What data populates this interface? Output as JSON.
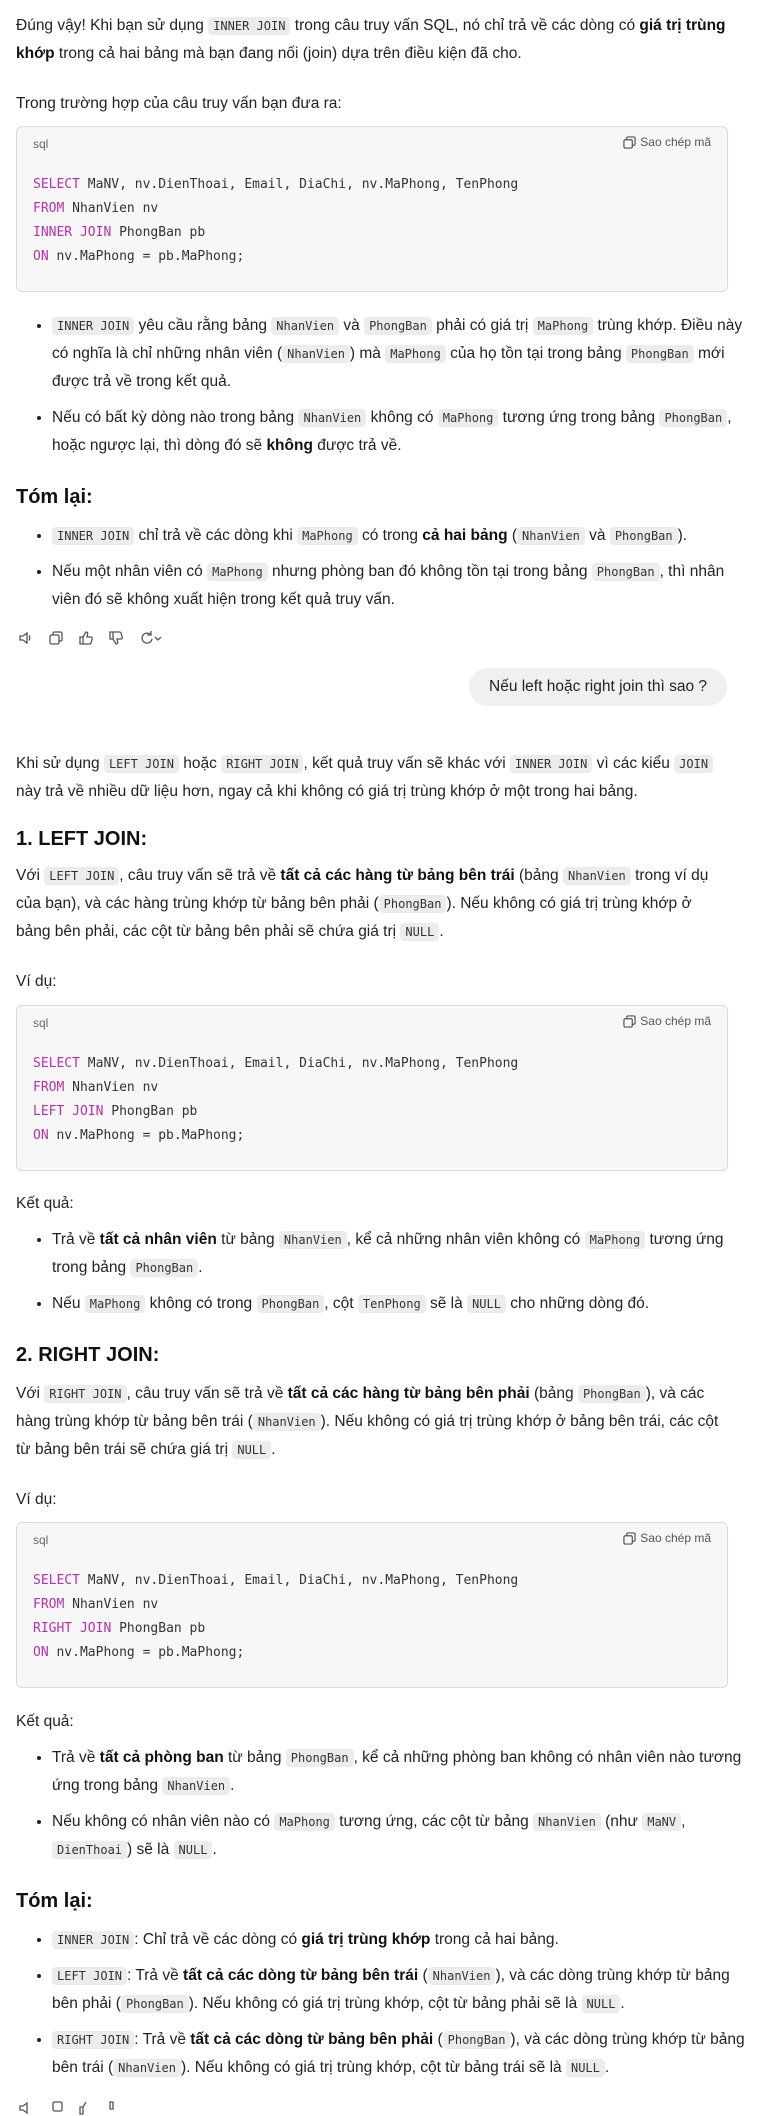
{
  "intro": {
    "p1_a": "Đúng vậy! Khi bạn sử dụng ",
    "p1_code": "INNER JOIN",
    "p1_b": " trong câu truy vấn SQL, nó chỉ trả về các dòng có ",
    "p1_bold": "giá trị trùng khớp",
    "p1_c": " trong cả hai bảng mà bạn đang nối (join) dựa trên điều kiện đã cho.",
    "p2": "Trong trường hợp của câu truy vấn bạn đưa ra:"
  },
  "code_ui": {
    "lang": "sql",
    "copy_label": "Sao chép mã"
  },
  "code1": {
    "l1_kw": "SELECT",
    "l1": " MaNV, nv.DienThoai, Email, DiaChi, nv.MaPhong, TenPhong",
    "l2_kw": "FROM",
    "l2": " NhanVien nv",
    "l3_kw": "INNER JOIN",
    "l3": " PhongBan pb",
    "l4_kw": "ON",
    "l4": " nv.MaPhong = pb.MaPhong;"
  },
  "bullets1": {
    "b1_code1": "INNER JOIN",
    "b1_a": " yêu cầu rằng bảng ",
    "b1_code2": "NhanVien",
    "b1_b": " và ",
    "b1_code3": "PhongBan",
    "b1_c": " phải có giá trị ",
    "b1_code4": "MaPhong",
    "b1_d": " trùng khớp. Điều này có nghĩa là chỉ những nhân viên (",
    "b1_code5": "NhanVien",
    "b1_e": ") mà ",
    "b1_code6": "MaPhong",
    "b1_f": " của họ tồn tại trong bảng ",
    "b1_code7": "PhongBan",
    "b1_g": " mới được trả về trong kết quả.",
    "b2_a": "Nếu có bất kỳ dòng nào trong bảng ",
    "b2_code1": "NhanVien",
    "b2_b": " không có ",
    "b2_code2": "MaPhong",
    "b2_c": " tương ứng trong bảng ",
    "b2_code3": "PhongBan",
    "b2_d": ", hoặc ngược lại, thì dòng đó sẽ ",
    "b2_bold": "không",
    "b2_e": " được trả về."
  },
  "summary1": {
    "title": "Tóm lại:",
    "s1_code1": "INNER JOIN",
    "s1_a": " chỉ trả về các dòng khi ",
    "s1_code2": "MaPhong",
    "s1_b": " có trong ",
    "s1_bold": "cả hai bảng",
    "s1_c": " (",
    "s1_code3": "NhanVien",
    "s1_d": " và ",
    "s1_code4": "PhongBan",
    "s1_e": ").",
    "s2_a": "Nếu một nhân viên có ",
    "s2_code1": "MaPhong",
    "s2_b": " nhưng phòng ban đó không tồn tại trong bảng ",
    "s2_code2": "PhongBan",
    "s2_c": ", thì nhân viên đó sẽ không xuất hiện trong kết quả truy vấn."
  },
  "user_message": "Nếu left hoặc right join thì sao ?",
  "answer": {
    "p1_a": "Khi sử dụng ",
    "p1_code1": "LEFT JOIN",
    "p1_b": " hoặc ",
    "p1_code2": "RIGHT JOIN",
    "p1_c": ", kết quả truy vấn sẽ khác với ",
    "p1_code3": "INNER JOIN",
    "p1_d": " vì các kiểu ",
    "p1_code4": "JOIN",
    "p1_e": " này trả về nhiều dữ liệu hơn, ngay cả khi không có giá trị trùng khớp ở một trong hai bảng."
  },
  "left": {
    "title": "1. LEFT JOIN:",
    "p_a": "Với ",
    "p_code1": "LEFT JOIN",
    "p_b": ", câu truy vấn sẽ trả về ",
    "p_bold": "tất cả các hàng từ bảng bên trái",
    "p_c": " (bảng ",
    "p_code2": "NhanVien",
    "p_d": " trong ví dụ của bạn), và các hàng trùng khớp từ bảng bên phải (",
    "p_code3": "PhongBan",
    "p_e": "). Nếu không có giá trị trùng khớp ở bảng bên phải, các cột từ bảng bên phải sẽ chứa giá trị ",
    "p_code4": "NULL",
    "p_f": ".",
    "example": "Ví dụ:",
    "result": "Kết quả:",
    "r1_a": "Trả về ",
    "r1_bold": "tất cả nhân viên",
    "r1_b": " từ bảng ",
    "r1_code1": "NhanVien",
    "r1_c": ", kể cả những nhân viên không có ",
    "r1_code2": "MaPhong",
    "r1_d": " tương ứng trong bảng ",
    "r1_code3": "PhongBan",
    "r1_e": ".",
    "r2_a": "Nếu ",
    "r2_code1": "MaPhong",
    "r2_b": " không có trong ",
    "r2_code2": "PhongBan",
    "r2_c": ", cột ",
    "r2_code3": "TenPhong",
    "r2_d": " sẽ là ",
    "r2_code4": "NULL",
    "r2_e": " cho những dòng đó."
  },
  "code2": {
    "l1_kw": "SELECT",
    "l1": " MaNV, nv.DienThoai, Email, DiaChi, nv.MaPhong, TenPhong",
    "l2_kw": "FROM",
    "l2": " NhanVien nv",
    "l3_kw": "LEFT JOIN",
    "l3": " PhongBan pb",
    "l4_kw": "ON",
    "l4": " nv.MaPhong = pb.MaPhong;"
  },
  "right": {
    "title": "2. RIGHT JOIN:",
    "p_a": "Với ",
    "p_code1": "RIGHT JOIN",
    "p_b": ", câu truy vấn sẽ trả về ",
    "p_bold": "tất cả các hàng từ bảng bên phải",
    "p_c": " (bảng ",
    "p_code2": "PhongBan",
    "p_d": "), và các hàng trùng khớp từ bảng bên trái (",
    "p_code3": "NhanVien",
    "p_e": "). Nếu không có giá trị trùng khớp ở bảng bên trái, các cột từ bảng bên trái sẽ chứa giá trị ",
    "p_code4": "NULL",
    "p_f": ".",
    "example": "Ví dụ:",
    "result": "Kết quả:",
    "r1_a": "Trả về ",
    "r1_bold": "tất cả phòng ban",
    "r1_b": " từ bảng ",
    "r1_code1": "PhongBan",
    "r1_c": ", kể cả những phòng ban không có nhân viên nào tương ứng trong bảng ",
    "r1_code2": "NhanVien",
    "r1_d": ".",
    "r2_a": "Nếu không có nhân viên nào có ",
    "r2_code1": "MaPhong",
    "r2_b": " tương ứng, các cột từ bảng ",
    "r2_code2": "NhanVien",
    "r2_c": " (như ",
    "r2_code3": "MaNV",
    "r2_d": ", ",
    "r2_code4": "DienThoai",
    "r2_e": ") sẽ là ",
    "r2_code5": "NULL",
    "r2_f": "."
  },
  "code3": {
    "l1_kw": "SELECT",
    "l1": " MaNV, nv.DienThoai, Email, DiaChi, nv.MaPhong, TenPhong",
    "l2_kw": "FROM",
    "l2": " NhanVien nv",
    "l3_kw": "RIGHT JOIN",
    "l3": " PhongBan pb",
    "l4_kw": "ON",
    "l4": " nv.MaPhong = pb.MaPhong;"
  },
  "summary2": {
    "title": "Tóm lại:",
    "s1_code": "INNER JOIN",
    "s1_a": ": Chỉ trả về các dòng có ",
    "s1_bold": "giá trị trùng khớp",
    "s1_b": " trong cả hai bảng.",
    "s2_code": "LEFT JOIN",
    "s2_a": ": Trả về ",
    "s2_bold": "tất cả các dòng từ bảng bên trái",
    "s2_b": " (",
    "s2_code2": "NhanVien",
    "s2_c": "), và các dòng trùng khớp từ bảng bên phải (",
    "s2_code3": "PhongBan",
    "s2_d": "). Nếu không có giá trị trùng khớp, cột từ bảng phải sẽ là ",
    "s2_code4": "NULL",
    "s2_e": ".",
    "s3_code": "RIGHT JOIN",
    "s3_a": ": Trả về ",
    "s3_bold": "tất cả các dòng từ bảng bên phải",
    "s3_b": " (",
    "s3_code2": "PhongBan",
    "s3_c": "), và các dòng trùng khớp từ bảng bên trái (",
    "s3_code3": "NhanVien",
    "s3_d": "). Nếu không có giá trị trùng khớp, cột từ bảng trái sẽ là ",
    "s3_code4": "NULL",
    "s3_e": "."
  },
  "toolbar_icons": [
    "speaker-icon",
    "copy-icon",
    "thumbs-up-icon",
    "thumbs-down-icon",
    "regenerate-icon"
  ],
  "colors": {
    "keyword": "#b92fa8",
    "code_bg": "#ececec",
    "bubble_bg": "#f0f0f0"
  }
}
